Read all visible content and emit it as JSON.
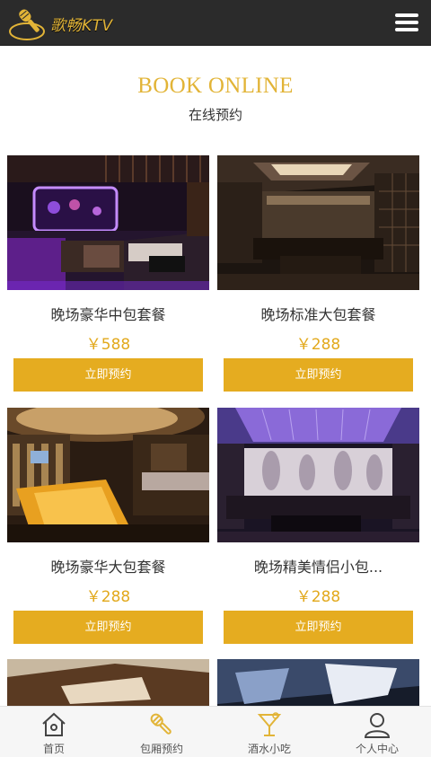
{
  "header": {
    "logo_text": "歌畅KTV",
    "brand_color": "#e2b437",
    "menu_icon": "hamburger-menu-icon"
  },
  "section": {
    "title_en": "BOOK ONLINE",
    "title_zh": "在线预约"
  },
  "packages": [
    {
      "name": "晚场豪华中包套餐",
      "price": "￥588",
      "button": "立即预约",
      "image": "ktv-room-purple-neon"
    },
    {
      "name": "晚场标准大包套餐",
      "price": "￥288",
      "button": "立即预约",
      "image": "ktv-room-dark-lounge"
    },
    {
      "name": "晚场豪华大包套餐",
      "price": "￥288",
      "button": "立即预约",
      "image": "ktv-room-gold-glow"
    },
    {
      "name": "晚场精美情侣小包...",
      "price": "￥288",
      "button": "立即预约",
      "image": "ktv-room-violet-ceiling"
    },
    {
      "name": "",
      "price": "",
      "button": "",
      "image": "ktv-room-wood"
    },
    {
      "name": "",
      "price": "",
      "button": "",
      "image": "ktv-room-blue"
    }
  ],
  "bottom_nav": [
    {
      "label": "首页",
      "icon": "home-icon"
    },
    {
      "label": "包厢预约",
      "icon": "microphone-icon"
    },
    {
      "label": "酒水小吃",
      "icon": "cocktail-icon"
    },
    {
      "label": "个人中心",
      "icon": "user-icon"
    }
  ],
  "colors": {
    "accent": "#e5ac20",
    "header_bg": "#2b2b2b",
    "price": "#e2a91d"
  }
}
